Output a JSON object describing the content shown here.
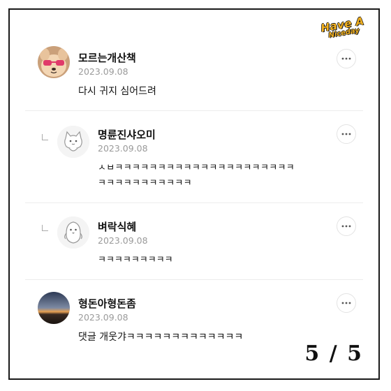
{
  "logo": {
    "line1": "Have A",
    "line2": "Niceday"
  },
  "comments": [
    {
      "name": "모르는개산책",
      "date": "2023.09.08",
      "text": "다시 귀지 심어드려",
      "more_icon": "ellipsis-icon",
      "avatar": "dog-photo-avatar"
    },
    {
      "name": "명륜진샤오미",
      "date": "2023.09.08",
      "text": "ㅅㅂㅋㅋㅋㅋㅋㅋㅋㅋㅋㅋㅋㅋㅋㅋㅋㅋㅋㅋㅋㅋㅋ\nㅋㅋㅋㅋㅋㅋㅋㅋㅋㅋㅋ",
      "more_icon": "ellipsis-icon",
      "avatar": "cat-default-avatar",
      "is_reply": true
    },
    {
      "name": "벼락식혜",
      "date": "2023.09.08",
      "text": "ㅋㅋㅋㅋㅋㅋㅋㅋㅋ",
      "more_icon": "ellipsis-icon",
      "avatar": "penguin-default-avatar",
      "is_reply": true
    },
    {
      "name": "형돈아형돈좀",
      "date": "2023.09.08",
      "text": "댓글 개웃갸ㅋㅋㅋㅋㅋㅋㅋㅋㅋㅋㅋㅋㅋ",
      "more_icon": "ellipsis-icon",
      "avatar": "sunset-photo-avatar"
    }
  ],
  "page_indicator": "5 / 5"
}
